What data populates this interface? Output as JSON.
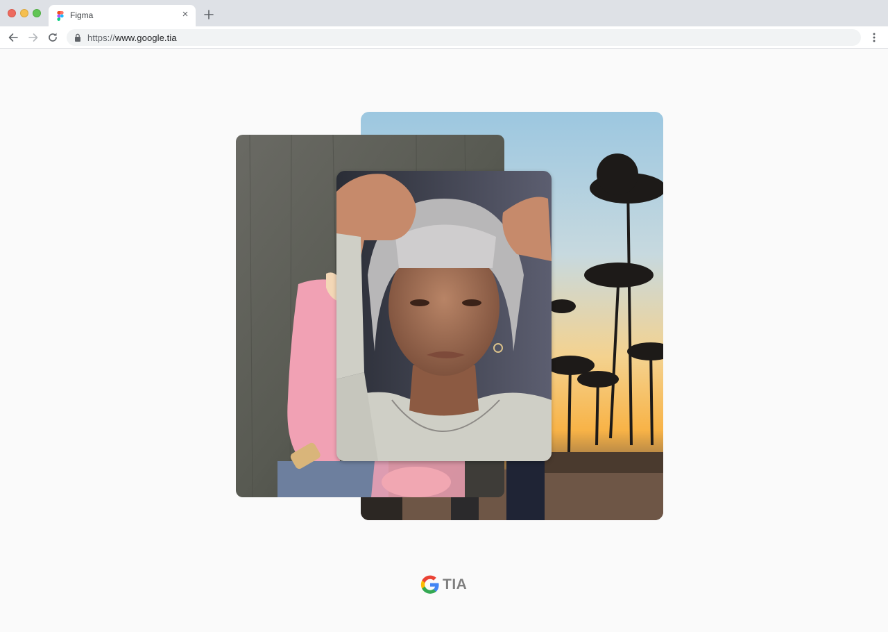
{
  "window": {
    "traffic_lights": [
      "close",
      "minimize",
      "zoom"
    ]
  },
  "tab": {
    "title": "Figma",
    "favicon": "figma-icon",
    "close_icon": "close-icon"
  },
  "newtab": {
    "icon": "plus-icon"
  },
  "toolbar": {
    "back_icon": "arrow-left-icon",
    "forward_icon": "arrow-right-icon",
    "reload_icon": "reload-icon",
    "menu_icon": "kebab-menu-icon"
  },
  "address_bar": {
    "scheme": "https://",
    "host": "www.google.tia",
    "lock_icon": "lock-icon"
  },
  "gallery": {
    "images": [
      {
        "name": "palm-trees-sunset-photo"
      },
      {
        "name": "skateboarder-pink-sweater-photo"
      },
      {
        "name": "man-bucket-hat-portrait-photo"
      }
    ]
  },
  "brand": {
    "logo": "google-g-logo",
    "text": "TIA"
  },
  "colors": {
    "chrome_tab_strip": "#dee1e6",
    "omnibox": "#f1f3f4",
    "page_background": "#fafafa",
    "brand_text": "#7f7f7f",
    "google_blue": "#4285f4",
    "google_red": "#ea4335",
    "google_yellow": "#fbbc05",
    "google_green": "#34a853"
  }
}
